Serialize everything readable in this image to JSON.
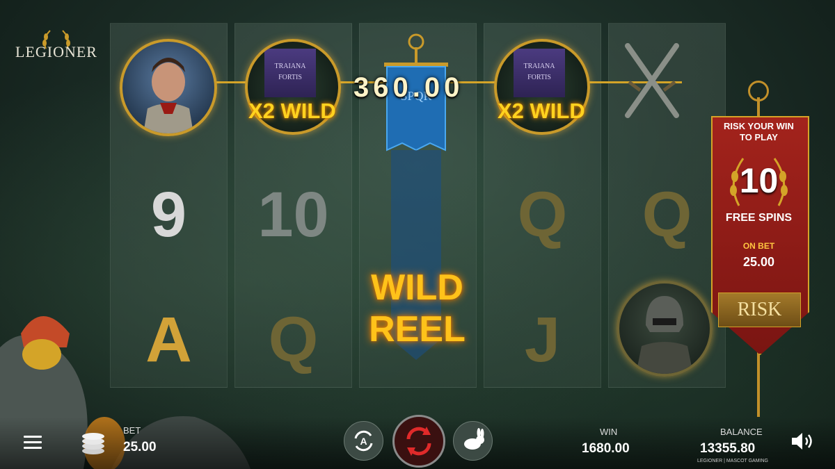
{
  "game": {
    "logo": "LEGIONER"
  },
  "reels": [
    {
      "symbols": [
        "",
        "9",
        "A"
      ],
      "colors": [
        "",
        "#d8d8d8",
        "#d2a238"
      ]
    },
    {
      "symbols": [
        "",
        "10",
        "Q"
      ],
      "colors": [
        "",
        "#7e8783",
        "#6e6535"
      ]
    },
    {
      "symbols": [
        "",
        "",
        ""
      ],
      "colors": [
        "",
        "",
        ""
      ]
    },
    {
      "symbols": [
        "",
        "Q",
        "J"
      ],
      "colors": [
        "",
        "#6e6535",
        "#6e6535"
      ]
    },
    {
      "symbols": [
        "",
        "Q",
        ""
      ],
      "colors": [
        "",
        "#6e6535",
        ""
      ]
    }
  ],
  "wild_symbol": {
    "banner_line1": "TRAIANA",
    "banner_line2": "FORTIS",
    "label": "X2 WILD"
  },
  "win_line_amount": "360.00",
  "center_banner": {
    "text": "SPQR"
  },
  "wild_reel": {
    "line1": "WILD",
    "line2": "REEL"
  },
  "risk_feature": {
    "title_line1": "RISK YOUR WIN",
    "title_line2": "TO PLAY",
    "free_spins_count": "10",
    "free_spins_label": "FREE SPINS",
    "on_bet_label": "ON BET",
    "on_bet_value": "25.00",
    "risk_button_label": "RISK"
  },
  "bottom_bar": {
    "bet_label": "BET",
    "bet_value": "25.00",
    "win_label": "WIN",
    "win_value": "1680.00",
    "balance_label": "BALANCE",
    "balance_value": "13355.80",
    "footer": "LEGIONER | MASCOT GAMING"
  },
  "colors": {
    "gold": "#d4a428",
    "wild_glow": "#ffc21a",
    "risk_red": "#a3231c"
  },
  "icons": [
    "menu-icon",
    "coins-icon",
    "autoplay-icon",
    "spin-icon",
    "turbo-rabbit-icon",
    "speaker-icon",
    "crossed-swords-icon",
    "laurel-wreath-icon"
  ]
}
